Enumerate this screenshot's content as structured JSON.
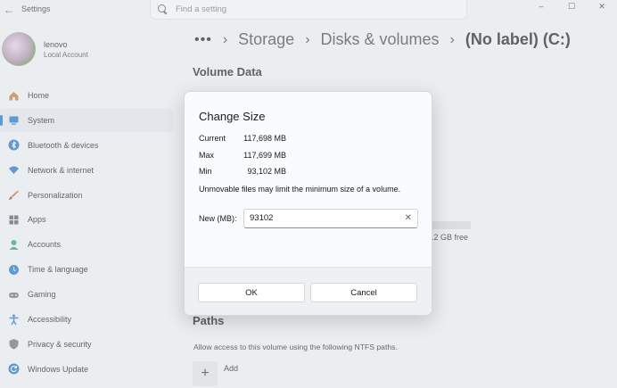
{
  "app": {
    "title": "Settings"
  },
  "search": {
    "placeholder": "Find a setting"
  },
  "window_controls": {
    "minimize": "–",
    "maximize": "☐",
    "close": "✕"
  },
  "profile": {
    "name": "lenovo",
    "account_type": "Local Account"
  },
  "sidebar": {
    "items": [
      {
        "label": "Home",
        "icon": "home-icon",
        "color": "#c27c2c"
      },
      {
        "label": "System",
        "icon": "system-icon",
        "color": "#1a73c7",
        "active": true
      },
      {
        "label": "Bluetooth & devices",
        "icon": "bluetooth-icon",
        "color": "#1a73c7"
      },
      {
        "label": "Network & internet",
        "icon": "wifi-icon",
        "color": "#1a73c7"
      },
      {
        "label": "Personalization",
        "icon": "brush-icon",
        "color": "#c56a3a"
      },
      {
        "label": "Apps",
        "icon": "apps-icon",
        "color": "#555b66"
      },
      {
        "label": "Accounts",
        "icon": "person-icon",
        "color": "#2f9e6a"
      },
      {
        "label": "Time & language",
        "icon": "globe-clock-icon",
        "color": "#1a73c7"
      },
      {
        "label": "Gaming",
        "icon": "gamepad-icon",
        "color": "#6b6f75"
      },
      {
        "label": "Accessibility",
        "icon": "accessibility-icon",
        "color": "#1a73c7"
      },
      {
        "label": "Privacy & security",
        "icon": "shield-icon",
        "color": "#6b6f75"
      },
      {
        "label": "Windows Update",
        "icon": "update-icon",
        "color": "#1a73c7"
      }
    ]
  },
  "breadcrumb": {
    "more": "•••",
    "parts": [
      "Storage",
      "Disks & volumes"
    ],
    "current": "(No label) (C:)",
    "separator": "›"
  },
  "main": {
    "volume_data_title": "Volume Data",
    "free_space_text": ".2 GB free",
    "paths_title": "Paths",
    "paths_description": "Allow access to this volume using the following NTFS paths.",
    "add_label": "Add",
    "add_glyph": "+"
  },
  "dialog": {
    "title": "Change Size",
    "rows": [
      {
        "label": "Current",
        "value": "117,698 MB"
      },
      {
        "label": "Max",
        "value": "117,699 MB"
      },
      {
        "label": "Min",
        "value": "93,102 MB"
      }
    ],
    "note": "Unmovable files may limit the minimum size of a volume.",
    "new_label": "New (MB):",
    "new_value": "93102",
    "clear_glyph": "✕",
    "ok_label": "OK",
    "cancel_label": "Cancel"
  }
}
